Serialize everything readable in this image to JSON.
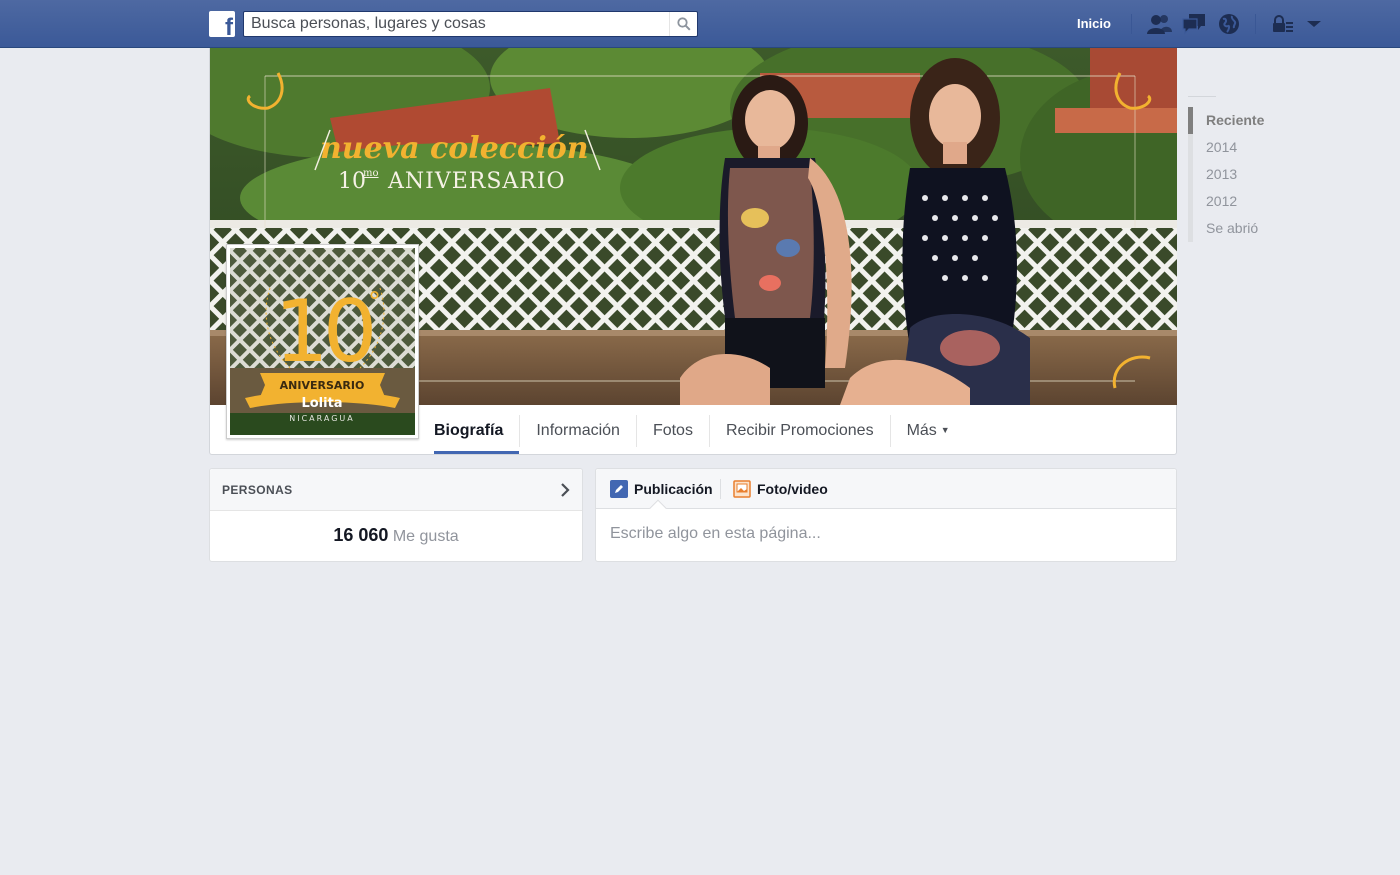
{
  "topbar": {
    "logo_letter": "f",
    "search_placeholder": "Busca personas, lugares y cosas",
    "home_label": "Inicio",
    "jewels": [
      "friend-requests-icon",
      "messages-icon",
      "notifications-globe-icon",
      "privacy-lock-icon",
      "account-menu-icon"
    ]
  },
  "cover": {
    "headline": "nueva colección",
    "subline_number": "10",
    "subline_suffix": "mo",
    "subline_text": "ANIVERSARIO"
  },
  "profile": {
    "badge_number": "10",
    "badge_degree": "°",
    "badge_ribbon": "ANIVERSARIO",
    "brand": "Lolita",
    "country": "NICARAGUA"
  },
  "tabs": [
    {
      "label": "Biografía",
      "active": true
    },
    {
      "label": "Información",
      "active": false
    },
    {
      "label": "Fotos",
      "active": false
    },
    {
      "label": "Recibir Promociones",
      "active": false
    },
    {
      "label": "Más",
      "active": false
    }
  ],
  "people": {
    "title": "PERSONAS",
    "likes_count": "16 060",
    "likes_label": "Me gusta"
  },
  "composer": {
    "tab_post": "Publicación",
    "tab_photo": "Foto/video",
    "placeholder": "Escribe algo en esta página..."
  },
  "years": [
    {
      "label": "Reciente",
      "active": true
    },
    {
      "label": "2014",
      "active": false
    },
    {
      "label": "2013",
      "active": false
    },
    {
      "label": "2012",
      "active": false
    },
    {
      "label": "Se abrió",
      "active": false
    }
  ],
  "colors": {
    "topbar": "#3b5998",
    "accent": "#4267b2",
    "badge_gold": "#f2b230",
    "page_bg": "#e9ebf0"
  }
}
